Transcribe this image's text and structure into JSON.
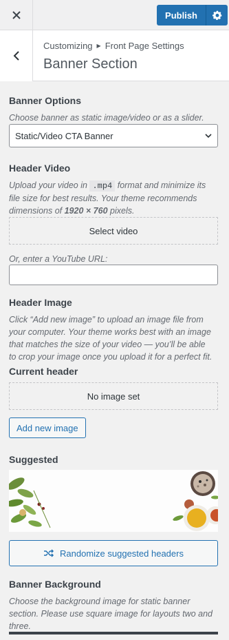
{
  "topbar": {
    "close_icon": "close-icon",
    "publish_label": "Publish",
    "settings_icon": "gear-icon",
    "accent": "#2271b1"
  },
  "section": {
    "breadcrumb_parent": "Customizing",
    "breadcrumb_child": "Front Page Settings",
    "title": "Banner Section",
    "back_icon": "chevron-left-icon"
  },
  "banner_options": {
    "title": "Banner Options",
    "description": "Choose banner as static image/video or as a slider.",
    "selected": "Static/Video CTA Banner"
  },
  "header_video": {
    "title": "Header Video",
    "desc_part1": "Upload your video in",
    "format_code": ".mp4",
    "desc_part2": "format and minimize its",
    "desc_line2": "file size for best results. Your theme recommends",
    "desc_line3_prefix": "dimensions of",
    "dimensions": "1920 × 760",
    "desc_line3_suffix": "pixels.",
    "select_label": "Select video",
    "youtube_label": "Or, enter a YouTube URL:",
    "youtube_value": ""
  },
  "header_image": {
    "title": "Header Image",
    "desc_line1": "Click “Add new image” to upload an image file from",
    "desc_line2": "your computer. Your theme works best with an image",
    "desc_line3": "that matches the size of your video — you’ll be able",
    "desc_line4": "to crop your image once you upload it for a perfect fit.",
    "current_title": "Current header",
    "no_image": "No image set",
    "add_label": "Add new image",
    "suggested_title": "Suggested",
    "randomize_label": "Randomize suggested headers",
    "randomize_icon": "shuffle-icon"
  },
  "banner_background": {
    "title": "Banner Background",
    "desc_line1": "Choose the background image for static banner",
    "desc_line2": "section. Please use square image for layouts two and",
    "desc_line3": "three."
  }
}
